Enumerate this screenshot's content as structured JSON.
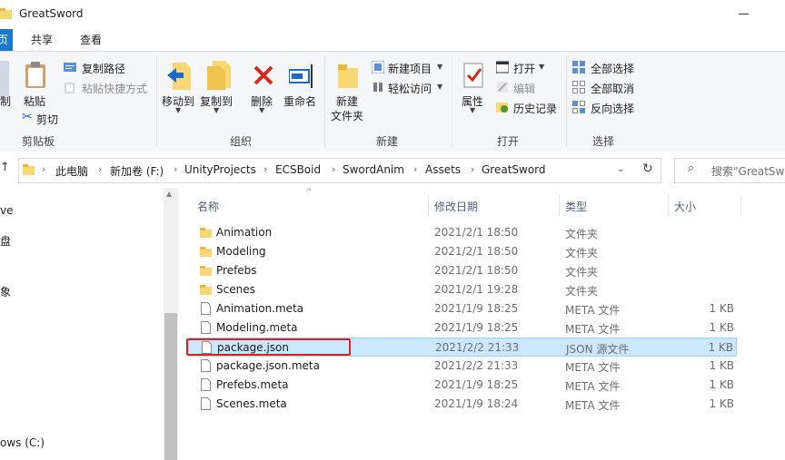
{
  "window": {
    "title": "GreatSword"
  },
  "tabs": {
    "file": "页",
    "share": "共享",
    "view": "查看"
  },
  "ribbon": {
    "clipboard": {
      "pin_label": "制",
      "paste": "粘贴",
      "copy_path": "复制路径",
      "paste_shortcut": "粘贴快捷方式",
      "cut": "剪切",
      "group": "剪贴板"
    },
    "organize": {
      "move_to": "移动到",
      "copy_to": "复制到",
      "delete": "删除",
      "rename": "重命名",
      "group": "组织"
    },
    "new": {
      "new_item": "新建项目",
      "easy_access": "轻松访问",
      "new_folder_line1": "新建",
      "new_folder_line2": "文件夹",
      "group": "新建"
    },
    "open": {
      "properties": "属性",
      "open": "打开",
      "edit": "编辑",
      "history": "历史记录",
      "group": "打开"
    },
    "select": {
      "select_all": "全部选择",
      "select_none": "全部取消",
      "invert": "反向选择",
      "group": "选择"
    }
  },
  "address": {
    "crumbs": [
      "此电脑",
      "新加卷 (F:)",
      "UnityProjects",
      "ECSBoid",
      "SwordAnim",
      "Assets",
      "GreatSword"
    ],
    "search_placeholder": "搜索\"GreatSwo"
  },
  "nav": {
    "items": [
      "ve",
      "盘",
      "象",
      "ows (C:)"
    ]
  },
  "columns": {
    "name": "名称",
    "date": "修改日期",
    "type": "类型",
    "size": "大小"
  },
  "files": [
    {
      "name": "Animation",
      "date": "2021/2/1 18:50",
      "type": "文件夹",
      "size": "",
      "kind": "folder"
    },
    {
      "name": "Modeling",
      "date": "2021/2/1 18:50",
      "type": "文件夹",
      "size": "",
      "kind": "folder"
    },
    {
      "name": "Prefebs",
      "date": "2021/2/1 18:50",
      "type": "文件夹",
      "size": "",
      "kind": "folder"
    },
    {
      "name": "Scenes",
      "date": "2021/2/1 19:28",
      "type": "文件夹",
      "size": "",
      "kind": "folder"
    },
    {
      "name": "Animation.meta",
      "date": "2021/1/9 18:25",
      "type": "META 文件",
      "size": "1 KB",
      "kind": "file"
    },
    {
      "name": "Modeling.meta",
      "date": "2021/1/9 18:25",
      "type": "META 文件",
      "size": "1 KB",
      "kind": "file"
    },
    {
      "name": "package.json",
      "date": "2021/2/2 21:33",
      "type": "JSON 源文件",
      "size": "1 KB",
      "kind": "file",
      "selected": true
    },
    {
      "name": "package.json.meta",
      "date": "2021/2/2 21:33",
      "type": "META 文件",
      "size": "1 KB",
      "kind": "file"
    },
    {
      "name": "Prefebs.meta",
      "date": "2021/1/9 18:25",
      "type": "META 文件",
      "size": "1 KB",
      "kind": "file"
    },
    {
      "name": "Scenes.meta",
      "date": "2021/1/9 18:24",
      "type": "META 文件",
      "size": "1 KB",
      "kind": "file"
    }
  ],
  "colors": {
    "accent": "#1979ca",
    "selection": "#cce8ff",
    "highlight_box": "#e0201c",
    "folder": "#f8d775"
  },
  "icons": {
    "minimize": "minimize-icon",
    "paste": "clipboard-icon",
    "copy_path": "copy-path-icon",
    "move_to": "move-to-icon",
    "copy_to": "copy-to-icon",
    "delete": "delete-x-icon",
    "rename": "rename-icon",
    "new_folder": "new-folder-icon",
    "properties": "properties-check-icon",
    "open": "open-icon",
    "select_all": "select-all-icon",
    "refresh": "refresh-icon",
    "search": "search-icon"
  }
}
